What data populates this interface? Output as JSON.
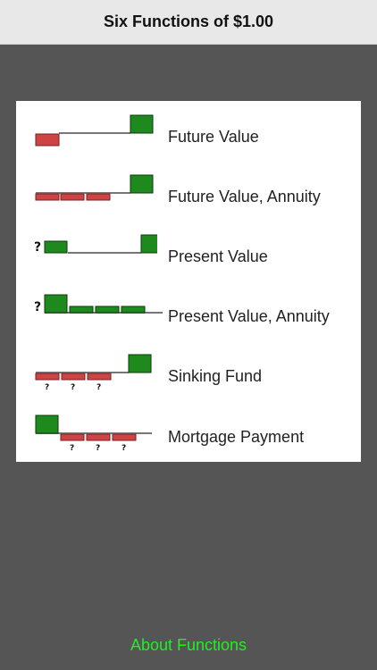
{
  "header": {
    "title": "Six Functions of $1.00"
  },
  "functions": [
    {
      "label": "Future Value",
      "icon": "future-value-diagram"
    },
    {
      "label": "Future Value, Annuity",
      "icon": "future-value-annuity-diagram"
    },
    {
      "label": "Present Value",
      "icon": "present-value-diagram"
    },
    {
      "label": "Present Value, Annuity",
      "icon": "present-value-annuity-diagram"
    },
    {
      "label": "Sinking Fund",
      "icon": "sinking-fund-diagram"
    },
    {
      "label": "Mortgage Payment",
      "icon": "mortgage-payment-diagram"
    }
  ],
  "diagram_glyph": "?",
  "footer": {
    "link_label": "About Functions"
  },
  "colors": {
    "navbar": "#e8e8e8",
    "background": "#555555",
    "panel": "#ffffff",
    "inflow_green": "#1e8a1e",
    "outflow_red": "#cc4444",
    "link": "#22ee22"
  }
}
